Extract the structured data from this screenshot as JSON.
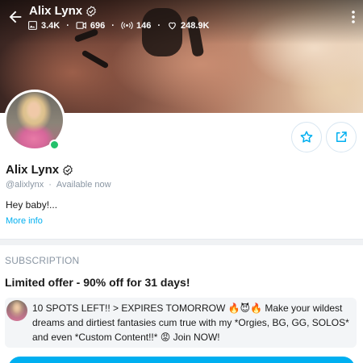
{
  "header": {
    "name": "Alix Lynx",
    "stats": [
      {
        "icon": "image-icon",
        "value": "3.4K"
      },
      {
        "icon": "video-icon",
        "value": "696"
      },
      {
        "icon": "stream-icon",
        "value": "146"
      },
      {
        "icon": "heart-icon",
        "value": "248.9K"
      }
    ]
  },
  "profile": {
    "name": "Alix Lynx",
    "handle": "@alixlynx",
    "separator": "·",
    "status": "Available now",
    "bio": "Hey baby!...",
    "more_info": "More info"
  },
  "subscription": {
    "heading": "SUBSCRIPTION",
    "offer": "Limited offer - 90% off for 31 days!",
    "promo_message": "10 SPOTS LEFT!! > EXPIRES TOMORROW 🔥😈🔥 Make your wildest dreams and dirtiest fantasies cum true with my *Orgies, BG, GG, SOLOS* and even *Custom Content!!* 😡 Join NOW!"
  },
  "colors": {
    "accent": "#00aff0",
    "online": "#23c16b",
    "muted": "#8a96a3"
  }
}
